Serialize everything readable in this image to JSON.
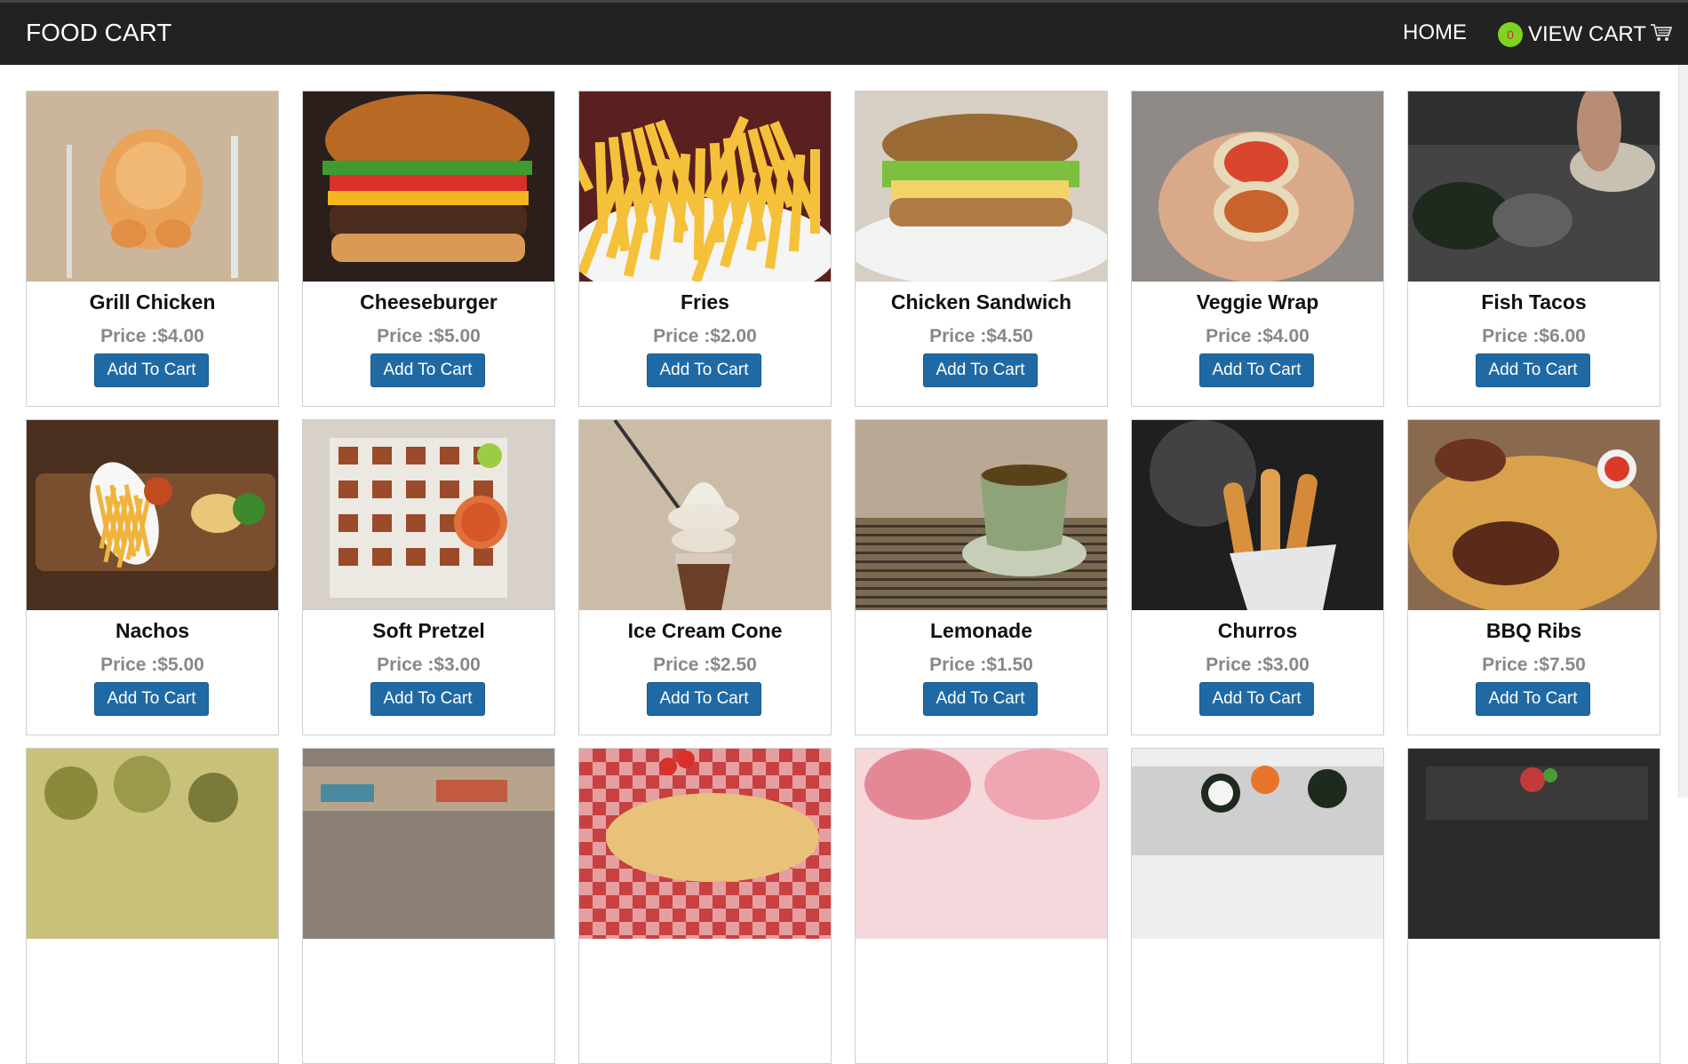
{
  "navbar": {
    "brand": "FOOD CART",
    "home_label": "HOME",
    "cart_count": "0",
    "cart_label": "VIEW CART",
    "cart_icon": "shopping-cart-icon"
  },
  "colors": {
    "navbar_bg": "#222222",
    "button_bg": "#1f6aa5",
    "cart_badge": "#7ed321",
    "price_text": "#888888"
  },
  "products": [
    {
      "name": "Grill Chicken",
      "price": "Price :$4.00",
      "button": "Add To Cart",
      "image": "grilled-chicken-image"
    },
    {
      "name": "Cheeseburger",
      "price": "Price :$5.00",
      "button": "Add To Cart",
      "image": "cheeseburger-image"
    },
    {
      "name": "Fries",
      "price": "Price :$2.00",
      "button": "Add To Cart",
      "image": "fries-image"
    },
    {
      "name": "Chicken Sandwich",
      "price": "Price :$4.50",
      "button": "Add To Cart",
      "image": "chicken-sandwich-image"
    },
    {
      "name": "Veggie Wrap",
      "price": "Price :$4.00",
      "button": "Add To Cart",
      "image": "veggie-wrap-image"
    },
    {
      "name": "Fish Tacos",
      "price": "Price :$6.00",
      "button": "Add To Cart",
      "image": "fish-tacos-image"
    },
    {
      "name": "Nachos",
      "price": "Price :$5.00",
      "button": "Add To Cart",
      "image": "nachos-image"
    },
    {
      "name": "Soft Pretzel",
      "price": "Price :$3.00",
      "button": "Add To Cart",
      "image": "soft-pretzel-image"
    },
    {
      "name": "Ice Cream Cone",
      "price": "Price :$2.50",
      "button": "Add To Cart",
      "image": "ice-cream-cone-image"
    },
    {
      "name": "Lemonade",
      "price": "Price :$1.50",
      "button": "Add To Cart",
      "image": "lemonade-image"
    },
    {
      "name": "Churros",
      "price": "Price :$3.00",
      "button": "Add To Cart",
      "image": "churros-image"
    },
    {
      "name": "BBQ Ribs",
      "price": "Price :$7.50",
      "button": "Add To Cart",
      "image": "bbq-ribs-image"
    },
    {
      "name": "",
      "price": "",
      "button": "",
      "image": "falafel-image"
    },
    {
      "name": "",
      "price": "",
      "button": "",
      "image": "market-image"
    },
    {
      "name": "",
      "price": "",
      "button": "",
      "image": "pizza-image"
    },
    {
      "name": "",
      "price": "",
      "button": "",
      "image": "cupcake-image"
    },
    {
      "name": "",
      "price": "",
      "button": "",
      "image": "sushi-image"
    },
    {
      "name": "",
      "price": "",
      "button": "",
      "image": "dessert-image"
    }
  ]
}
